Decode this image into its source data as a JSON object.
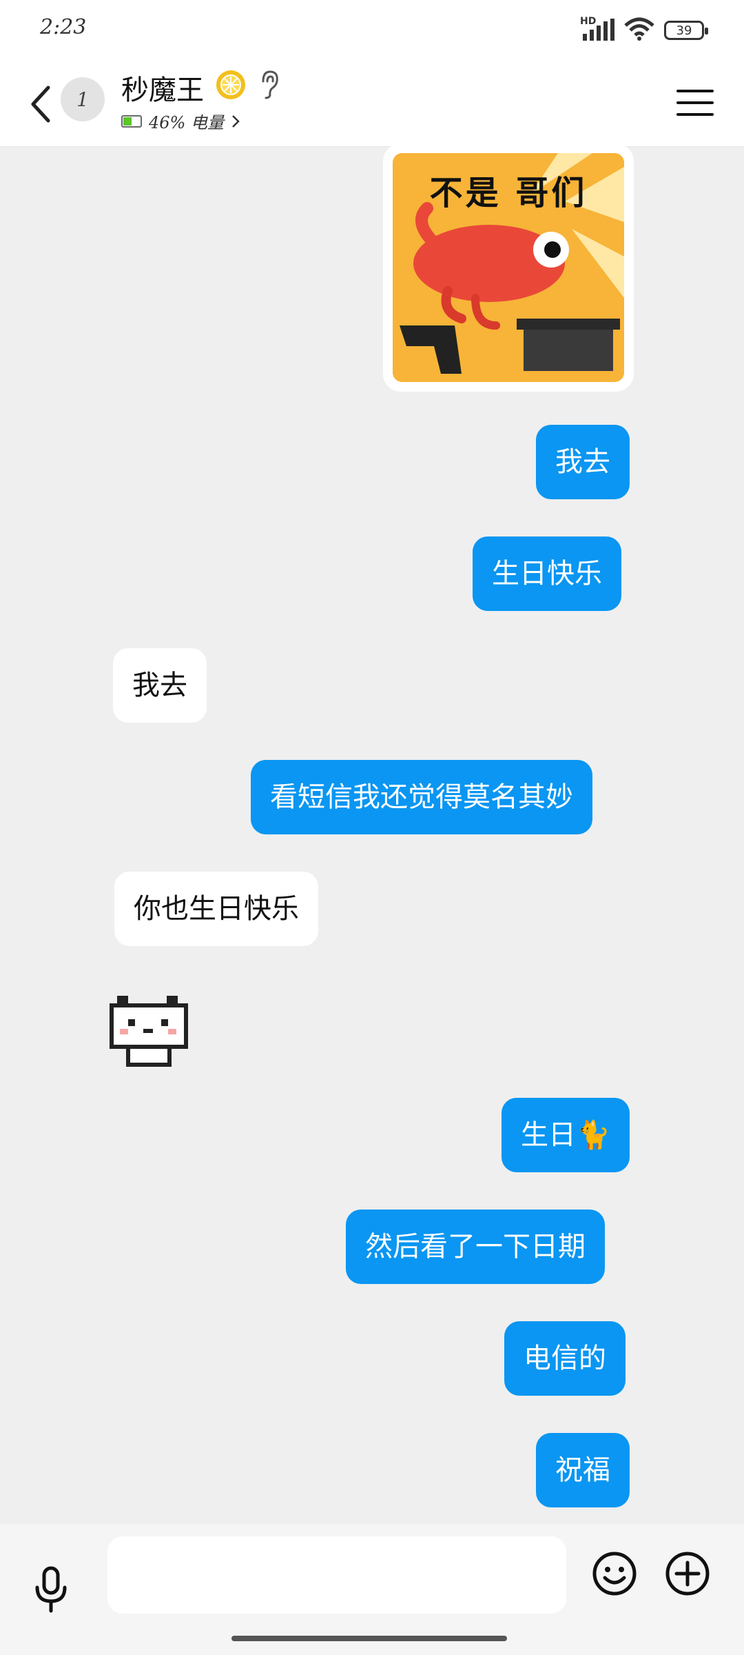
{
  "status_bar": {
    "time": "2:23",
    "network": "HD",
    "battery": "39"
  },
  "header": {
    "avatar_text": "1",
    "contact_name": "秒魔王",
    "battery_status": "46% 电量",
    "accent_color": "#0a96f2"
  },
  "messages": [
    {
      "side": "me",
      "type": "sticker",
      "text": "不是 哥们"
    },
    {
      "side": "me",
      "type": "text",
      "text": "我去"
    },
    {
      "side": "me",
      "type": "text",
      "text": "生日快乐"
    },
    {
      "side": "other",
      "type": "text",
      "text": "我去"
    },
    {
      "side": "me",
      "type": "text",
      "text": "看短信我还觉得莫名其妙"
    },
    {
      "side": "other",
      "type": "text",
      "text": "你也生日快乐"
    },
    {
      "side": "other",
      "type": "sticker",
      "text": ""
    },
    {
      "side": "me",
      "type": "text",
      "text": "生日🐈"
    },
    {
      "side": "me",
      "type": "text",
      "text": "然后看了一下日期"
    },
    {
      "side": "me",
      "type": "text",
      "text": "电信的"
    },
    {
      "side": "me",
      "type": "text",
      "text": "祝福"
    }
  ],
  "input": {
    "placeholder": ""
  }
}
